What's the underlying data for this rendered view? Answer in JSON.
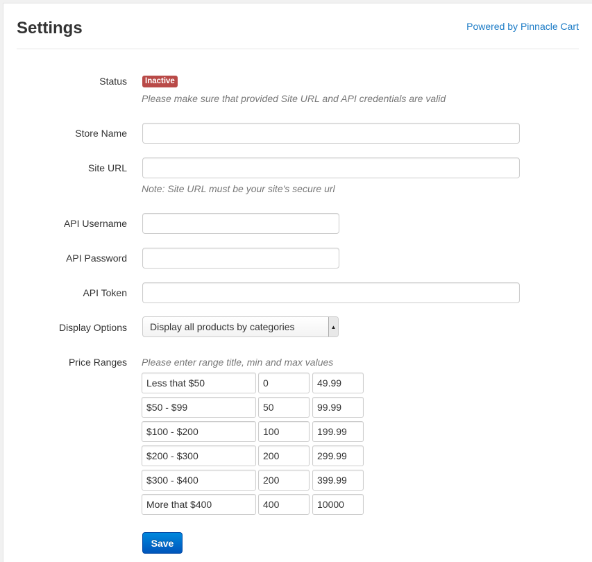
{
  "header": {
    "title": "Settings",
    "powered_link": "Powered by Pinnacle Cart"
  },
  "status": {
    "label": "Status",
    "badge": "Inactive",
    "badge_color": "#b94a48",
    "help": "Please make sure that provided Site URL and API credentials are valid"
  },
  "store_name": {
    "label": "Store Name",
    "value": ""
  },
  "site_url": {
    "label": "Site URL",
    "value": "",
    "help": "Note: Site URL must be your site's secure url"
  },
  "api_username": {
    "label": "API Username",
    "value": ""
  },
  "api_password": {
    "label": "API Password",
    "value": ""
  },
  "api_token": {
    "label": "API Token",
    "value": ""
  },
  "display_options": {
    "label": "Display Options",
    "selected": "Display all products by categories"
  },
  "price_ranges": {
    "label": "Price Ranges",
    "help": "Please enter range title, min and max values",
    "rows": [
      {
        "title": "Less that $50",
        "min": "0",
        "max": "49.99"
      },
      {
        "title": "$50 - $99",
        "min": "50",
        "max": "99.99"
      },
      {
        "title": "$100 - $200",
        "min": "100",
        "max": "199.99"
      },
      {
        "title": "$200 - $300",
        "min": "200",
        "max": "299.99"
      },
      {
        "title": "$300 - $400",
        "min": "200",
        "max": "399.99"
      },
      {
        "title": "More that $400",
        "min": "400",
        "max": "10000"
      }
    ]
  },
  "save_button": {
    "label": "Save",
    "color": "#0066cc"
  },
  "colors": {
    "link": "#1b7bc6",
    "badge": "#b94a48",
    "primary": "#0066cc"
  }
}
